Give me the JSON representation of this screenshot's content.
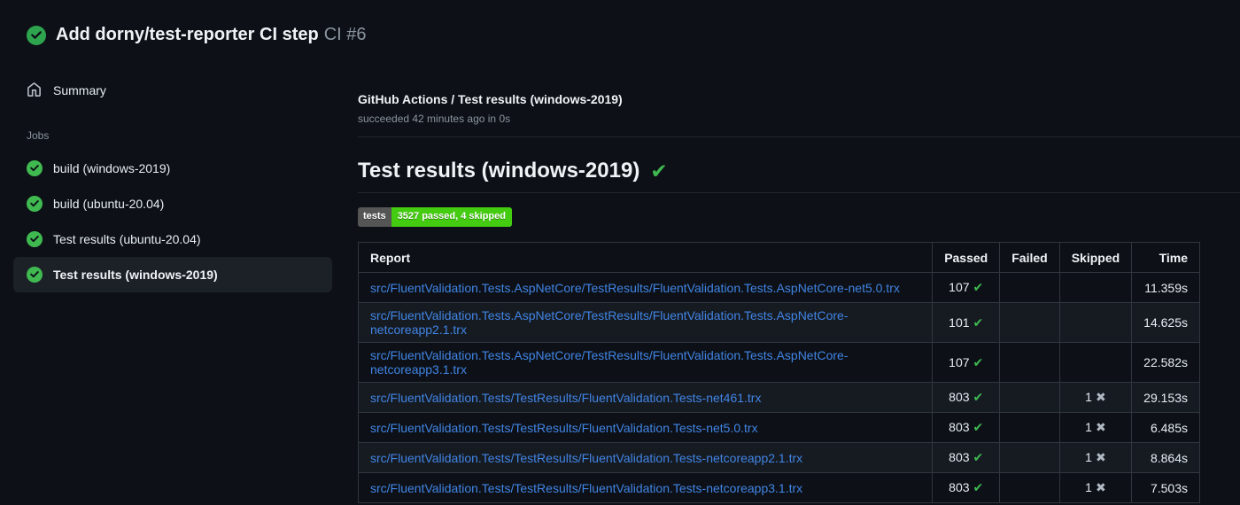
{
  "colors": {
    "page_bg": "#0d1117",
    "row_alt_bg": "#161b22",
    "border": "#30363d",
    "divider": "#21262d",
    "link_blue": "#4184e4",
    "success_green": "#3fb950",
    "muted_gray": "#8b949e",
    "selected_item_bg": "#1c2128",
    "badge_label_bg": "#555555",
    "badge_value_bg": "#44cc11"
  },
  "header": {
    "title": "Add dorny/test-reporter CI step",
    "run_number": "CI #6",
    "status_icon": "check-circle-icon"
  },
  "sidebar": {
    "summary_label": "Summary",
    "jobs_heading": "Jobs",
    "jobs": [
      {
        "label": "build (windows-2019)",
        "status": "success",
        "selected": false
      },
      {
        "label": "build (ubuntu-20.04)",
        "status": "success",
        "selected": false
      },
      {
        "label": "Test results (ubuntu-20.04)",
        "status": "success",
        "selected": false
      },
      {
        "label": "Test results (windows-2019)",
        "status": "success",
        "selected": true
      }
    ]
  },
  "main": {
    "breadcrumb": "GitHub Actions / Test results (windows-2019)",
    "status_line": "succeeded 42 minutes ago in 0s",
    "section_title": "Test results (windows-2019)",
    "section_status": "success",
    "badge": {
      "label": "tests",
      "value": "3527 passed, 4 skipped"
    },
    "table": {
      "columns": [
        "Report",
        "Passed",
        "Failed",
        "Skipped",
        "Time"
      ],
      "rows": [
        {
          "report": "src/FluentValidation.Tests.AspNetCore/TestResults/FluentValidation.Tests.AspNetCore-net5.0.trx",
          "passed": "107",
          "failed": "",
          "skipped": "",
          "time": "11.359s"
        },
        {
          "report": "src/FluentValidation.Tests.AspNetCore/TestResults/FluentValidation.Tests.AspNetCore-netcoreapp2.1.trx",
          "passed": "101",
          "failed": "",
          "skipped": "",
          "time": "14.625s"
        },
        {
          "report": "src/FluentValidation.Tests.AspNetCore/TestResults/FluentValidation.Tests.AspNetCore-netcoreapp3.1.trx",
          "passed": "107",
          "failed": "",
          "skipped": "",
          "time": "22.582s"
        },
        {
          "report": "src/FluentValidation.Tests/TestResults/FluentValidation.Tests-net461.trx",
          "passed": "803",
          "failed": "",
          "skipped": "1",
          "time": "29.153s"
        },
        {
          "report": "src/FluentValidation.Tests/TestResults/FluentValidation.Tests-net5.0.trx",
          "passed": "803",
          "failed": "",
          "skipped": "1",
          "time": "6.485s"
        },
        {
          "report": "src/FluentValidation.Tests/TestResults/FluentValidation.Tests-netcoreapp2.1.trx",
          "passed": "803",
          "failed": "",
          "skipped": "1",
          "time": "8.864s"
        },
        {
          "report": "src/FluentValidation.Tests/TestResults/FluentValidation.Tests-netcoreapp3.1.trx",
          "passed": "803",
          "failed": "",
          "skipped": "1",
          "time": "7.503s"
        }
      ],
      "glyphs": {
        "passed": "✔",
        "skipped": "✖"
      }
    }
  }
}
